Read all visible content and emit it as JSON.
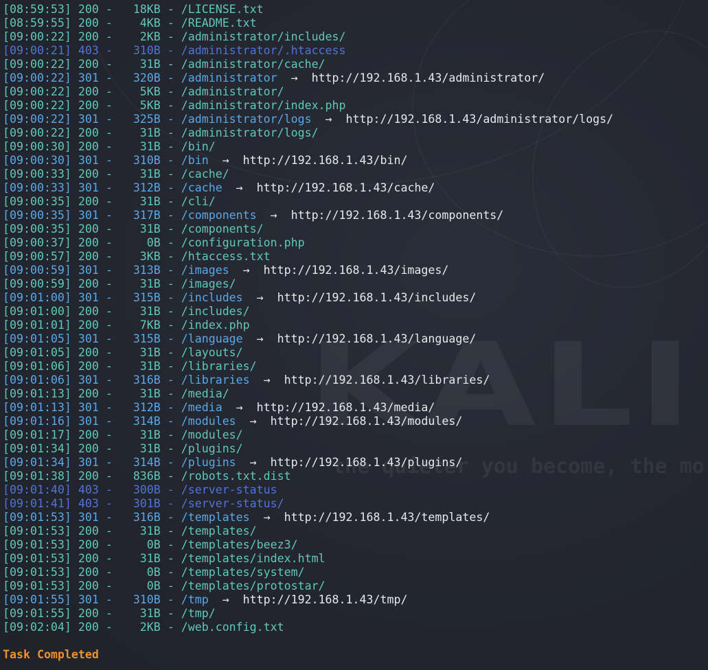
{
  "terminal": {
    "wallpaper": {
      "logo_text": "KALI LI",
      "tagline": "the quieter you become, the mo"
    },
    "colors": {
      "status_200": "#5fc9b9",
      "status_301": "#5aa8e6",
      "status_403": "#4f73d9",
      "redirect_target": "#e6e8ee",
      "task_completed": "#f0912a",
      "background": "#23262f"
    },
    "lines": [
      {
        "time": "[08:59:53]",
        "code": "200",
        "size": "18KB",
        "path": "/LICENSE.txt",
        "redirect": ""
      },
      {
        "time": "[08:59:55]",
        "code": "200",
        "size": "4KB",
        "path": "/README.txt",
        "redirect": ""
      },
      {
        "time": "[09:00:22]",
        "code": "200",
        "size": "2KB",
        "path": "/administrator/includes/",
        "redirect": ""
      },
      {
        "time": "[09:00:21]",
        "code": "403",
        "size": "310B",
        "path": "/administrator/.htaccess",
        "redirect": ""
      },
      {
        "time": "[09:00:22]",
        "code": "200",
        "size": "31B",
        "path": "/administrator/cache/",
        "redirect": ""
      },
      {
        "time": "[09:00:22]",
        "code": "301",
        "size": "320B",
        "path": "/administrator",
        "redirect": "http://192.168.1.43/administrator/"
      },
      {
        "time": "[09:00:22]",
        "code": "200",
        "size": "5KB",
        "path": "/administrator/",
        "redirect": ""
      },
      {
        "time": "[09:00:22]",
        "code": "200",
        "size": "5KB",
        "path": "/administrator/index.php",
        "redirect": ""
      },
      {
        "time": "[09:00:22]",
        "code": "301",
        "size": "325B",
        "path": "/administrator/logs",
        "redirect": "http://192.168.1.43/administrator/logs/"
      },
      {
        "time": "[09:00:22]",
        "code": "200",
        "size": "31B",
        "path": "/administrator/logs/",
        "redirect": ""
      },
      {
        "time": "[09:00:30]",
        "code": "200",
        "size": "31B",
        "path": "/bin/",
        "redirect": ""
      },
      {
        "time": "[09:00:30]",
        "code": "301",
        "size": "310B",
        "path": "/bin",
        "redirect": "http://192.168.1.43/bin/"
      },
      {
        "time": "[09:00:33]",
        "code": "200",
        "size": "31B",
        "path": "/cache/",
        "redirect": ""
      },
      {
        "time": "[09:00:33]",
        "code": "301",
        "size": "312B",
        "path": "/cache",
        "redirect": "http://192.168.1.43/cache/"
      },
      {
        "time": "[09:00:35]",
        "code": "200",
        "size": "31B",
        "path": "/cli/",
        "redirect": ""
      },
      {
        "time": "[09:00:35]",
        "code": "301",
        "size": "317B",
        "path": "/components",
        "redirect": "http://192.168.1.43/components/"
      },
      {
        "time": "[09:00:35]",
        "code": "200",
        "size": "31B",
        "path": "/components/",
        "redirect": ""
      },
      {
        "time": "[09:00:37]",
        "code": "200",
        "size": "0B",
        "path": "/configuration.php",
        "redirect": ""
      },
      {
        "time": "[09:00:57]",
        "code": "200",
        "size": "3KB",
        "path": "/htaccess.txt",
        "redirect": ""
      },
      {
        "time": "[09:00:59]",
        "code": "301",
        "size": "313B",
        "path": "/images",
        "redirect": "http://192.168.1.43/images/"
      },
      {
        "time": "[09:00:59]",
        "code": "200",
        "size": "31B",
        "path": "/images/",
        "redirect": ""
      },
      {
        "time": "[09:01:00]",
        "code": "301",
        "size": "315B",
        "path": "/includes",
        "redirect": "http://192.168.1.43/includes/"
      },
      {
        "time": "[09:01:00]",
        "code": "200",
        "size": "31B",
        "path": "/includes/",
        "redirect": ""
      },
      {
        "time": "[09:01:01]",
        "code": "200",
        "size": "7KB",
        "path": "/index.php",
        "redirect": ""
      },
      {
        "time": "[09:01:05]",
        "code": "301",
        "size": "315B",
        "path": "/language",
        "redirect": "http://192.168.1.43/language/"
      },
      {
        "time": "[09:01:05]",
        "code": "200",
        "size": "31B",
        "path": "/layouts/",
        "redirect": ""
      },
      {
        "time": "[09:01:06]",
        "code": "200",
        "size": "31B",
        "path": "/libraries/",
        "redirect": ""
      },
      {
        "time": "[09:01:06]",
        "code": "301",
        "size": "316B",
        "path": "/libraries",
        "redirect": "http://192.168.1.43/libraries/"
      },
      {
        "time": "[09:01:13]",
        "code": "200",
        "size": "31B",
        "path": "/media/",
        "redirect": ""
      },
      {
        "time": "[09:01:13]",
        "code": "301",
        "size": "312B",
        "path": "/media",
        "redirect": "http://192.168.1.43/media/"
      },
      {
        "time": "[09:01:16]",
        "code": "301",
        "size": "314B",
        "path": "/modules",
        "redirect": "http://192.168.1.43/modules/"
      },
      {
        "time": "[09:01:17]",
        "code": "200",
        "size": "31B",
        "path": "/modules/",
        "redirect": ""
      },
      {
        "time": "[09:01:34]",
        "code": "200",
        "size": "31B",
        "path": "/plugins/",
        "redirect": ""
      },
      {
        "time": "[09:01:34]",
        "code": "301",
        "size": "314B",
        "path": "/plugins",
        "redirect": "http://192.168.1.43/plugins/"
      },
      {
        "time": "[09:01:38]",
        "code": "200",
        "size": "836B",
        "path": "/robots.txt.dist",
        "redirect": ""
      },
      {
        "time": "[09:01:40]",
        "code": "403",
        "size": "300B",
        "path": "/server-status",
        "redirect": ""
      },
      {
        "time": "[09:01:41]",
        "code": "403",
        "size": "301B",
        "path": "/server-status/",
        "redirect": ""
      },
      {
        "time": "[09:01:53]",
        "code": "301",
        "size": "316B",
        "path": "/templates",
        "redirect": "http://192.168.1.43/templates/"
      },
      {
        "time": "[09:01:53]",
        "code": "200",
        "size": "31B",
        "path": "/templates/",
        "redirect": ""
      },
      {
        "time": "[09:01:53]",
        "code": "200",
        "size": "0B",
        "path": "/templates/beez3/",
        "redirect": ""
      },
      {
        "time": "[09:01:53]",
        "code": "200",
        "size": "31B",
        "path": "/templates/index.html",
        "redirect": ""
      },
      {
        "time": "[09:01:53]",
        "code": "200",
        "size": "0B",
        "path": "/templates/system/",
        "redirect": ""
      },
      {
        "time": "[09:01:53]",
        "code": "200",
        "size": "0B",
        "path": "/templates/protostar/",
        "redirect": ""
      },
      {
        "time": "[09:01:55]",
        "code": "301",
        "size": "310B",
        "path": "/tmp",
        "redirect": "http://192.168.1.43/tmp/"
      },
      {
        "time": "[09:01:55]",
        "code": "200",
        "size": "31B",
        "path": "/tmp/",
        "redirect": ""
      },
      {
        "time": "[09:02:04]",
        "code": "200",
        "size": "2KB",
        "path": "/web.config.txt",
        "redirect": ""
      }
    ],
    "status_message": "Task Completed"
  }
}
